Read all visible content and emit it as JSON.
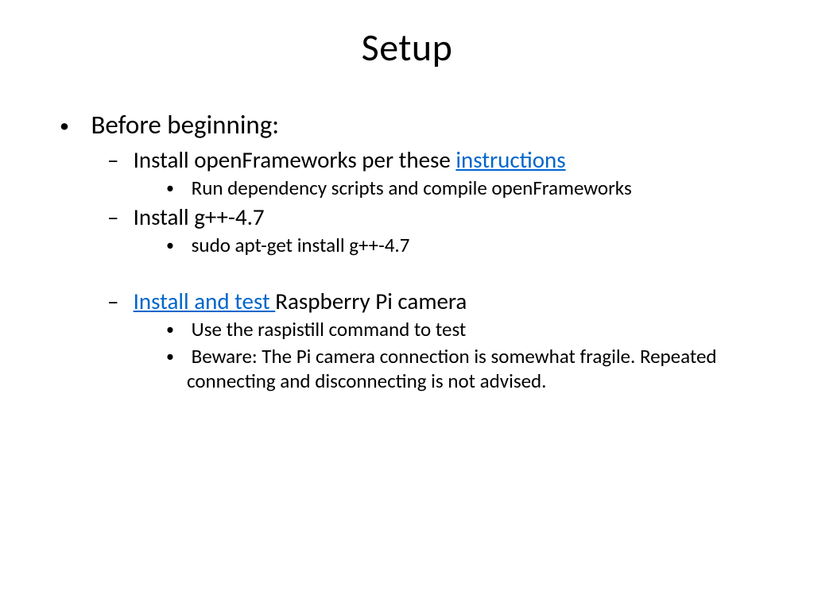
{
  "title": "Setup",
  "bullets": {
    "l1_before": "Before beginning:",
    "l2_install_of_pre": "Install openFrameworks per these ",
    "l2_install_of_link": "instructions",
    "l3_run_dep": "Run dependency scripts and compile openFrameworks",
    "l2_install_gpp": "Install g++-4.7",
    "l3_sudo": "sudo apt-get install g++-4.7",
    "l2_install_test_link": "Install and test ",
    "l2_install_test_rest": "Raspberry Pi camera",
    "l3_raspistill": "Use the raspistill command to test",
    "l3_beware": "Beware: The Pi camera connection is somewhat fragile. Repeated connecting and disconnecting is not advised."
  }
}
